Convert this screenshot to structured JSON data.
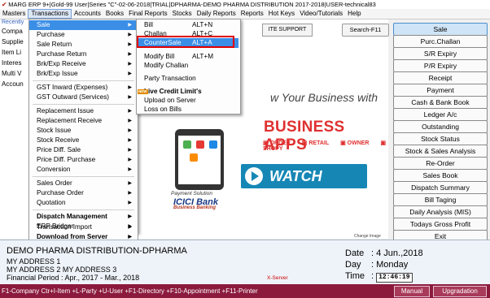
{
  "titlebar": {
    "text": "MARG ERP 9+|Gold-99 User|Series \"C\"-02-06-2018|TRIAL|DPHARMA-DEMO PHARMA DISTRIBUTION 2017-2018|USER-technical83"
  },
  "menubar": {
    "items": [
      "Masters",
      "Transactions",
      "Accounts",
      "Books",
      "Final Reports",
      "Stocks",
      "Daily Reports",
      "Reports",
      "Hot Keys",
      "Video/Tutorials",
      "Help"
    ],
    "active": "Transactions"
  },
  "leftpane": {
    "recent": "Recently",
    "items": [
      "Compa",
      "Supplie",
      "Item Li",
      "Interes",
      "Multi V",
      "Accoun"
    ]
  },
  "main": {
    "support": "ITE SUPPORT",
    "search": "Search-F11",
    "banner_line": "w Your Business with",
    "apps": "BUSINESS APPS",
    "tags": [
      "ORDER",
      "RETAIL",
      "OWNER",
      "SHOPY"
    ],
    "payment": "Payment Solution",
    "bank": "ICICI Bank",
    "bank_sub": "Business Banking",
    "watch": "WATCH VIDEO",
    "change_image": "Change Image"
  },
  "dropdown": {
    "items": [
      "Sale",
      "Purchase",
      "Sale Return",
      "Purchase Return",
      "Brk/Exp Receive",
      "Brk/Exp Issue",
      "GST Inward (Expenses)",
      "GST Outward (Services)",
      "Replacement Issue",
      "Replacement Receive",
      "Stock Issue",
      "Stock Receive",
      "Price Diff. Sale",
      "Price Diff. Purchase",
      "Conversion",
      "Sales Order",
      "Purchase Order",
      "Quotation",
      "Dispatch Management",
      "ERP Bridger",
      "Transaction Import",
      "Download from Server"
    ]
  },
  "submenu": {
    "items": [
      {
        "label": "Bill",
        "shortcut": "ALT+N"
      },
      {
        "label": "Challan",
        "shortcut": "ALT+C"
      },
      {
        "label": "CounterSale",
        "shortcut": "ALT+A"
      },
      {
        "label": "Modify Bill",
        "shortcut": "ALT+M"
      },
      {
        "label": "Modify Challan",
        "shortcut": ""
      },
      {
        "label": "Party Transaction",
        "shortcut": ""
      },
      {
        "label": "Live Credit Limit's",
        "shortcut": ""
      },
      {
        "label": "Upload on Server",
        "shortcut": ""
      },
      {
        "label": "Loss on Bills",
        "shortcut": ""
      }
    ],
    "new_badge": "NEW"
  },
  "rightpanel": {
    "buttons": [
      "Sale",
      "Purc.Challan",
      "S/R Expiry",
      "P/R Expiry",
      "Receipt",
      "Payment",
      "Cash & Bank Book",
      "Ledger A/c",
      "Outstanding",
      "Stock Status",
      "Stock & Sales Analysis",
      "Re-Order",
      "Sales Book",
      "Dispatch Summary",
      "Bill Taging",
      "Daily Analysis (MIS)",
      "Todays Gross Profit",
      "Exit"
    ]
  },
  "info": {
    "company": "DEMO PHARMA DISTRIBUTION-DPHARMA",
    "addr1": "MY ADDRESS 1",
    "addr2": "MY ADDRESS 2 MY ADDRESS 3",
    "period": "Financial Period : Apr., 2017 - Mar., 2018",
    "xserver": "X-Server",
    "date_label": "Date",
    "date": ": 4 Jun.,2018",
    "day_label": "Day",
    "day": ": Monday",
    "time_label": "Time",
    "time": "12:46:19"
  },
  "statusbar": {
    "text": "F1-Company Ctr+I-Item +L-Party +U-User +F1-Directory +F10-Appointment +F11-Printer",
    "manual": "Manual",
    "upgradation": "Upgradation"
  },
  "colors": {
    "accent": "#3a8ee6",
    "status_bg": "#8b1a3d",
    "apps_red": "#e03030",
    "highlight_box": "#e00000"
  }
}
